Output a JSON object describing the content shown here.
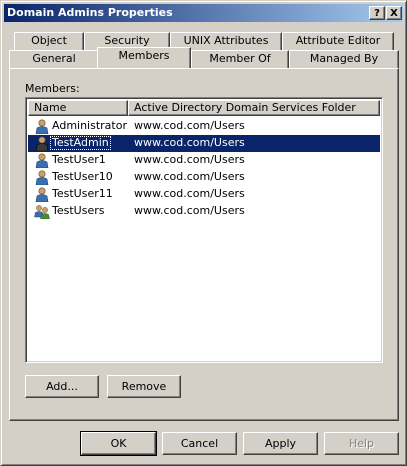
{
  "window": {
    "title": "Domain Admins Properties",
    "help_glyph": "?",
    "close_glyph": "X"
  },
  "tabs": {
    "back_row": [
      {
        "label": "Object"
      },
      {
        "label": "Security"
      },
      {
        "label": "UNIX Attributes"
      },
      {
        "label": "Attribute Editor"
      }
    ],
    "front_row": [
      {
        "label": "General"
      },
      {
        "label": "Members",
        "selected": true
      },
      {
        "label": "Member Of"
      },
      {
        "label": "Managed By"
      }
    ]
  },
  "members": {
    "label": "Members:",
    "columns": [
      "Name",
      "Active Directory Domain Services Folder"
    ],
    "rows": [
      {
        "name": "Administrator",
        "folder": "www.cod.com/Users",
        "icon": "user-icon"
      },
      {
        "name": "TestAdmin",
        "folder": "www.cod.com/Users",
        "icon": "user-icon",
        "selected": true
      },
      {
        "name": "TestUser1",
        "folder": "www.cod.com/Users",
        "icon": "user-icon"
      },
      {
        "name": "TestUser10",
        "folder": "www.cod.com/Users",
        "icon": "user-icon"
      },
      {
        "name": "TestUser11",
        "folder": "www.cod.com/Users",
        "icon": "user-icon"
      },
      {
        "name": "TestUsers",
        "folder": "www.cod.com/Users",
        "icon": "group-icon"
      }
    ],
    "add_button": "Add...",
    "remove_button": "Remove"
  },
  "footer": {
    "ok": "OK",
    "cancel": "Cancel",
    "apply": "Apply",
    "help": "Help"
  },
  "colors": {
    "face": "#d4d0c8",
    "selection": "#0a246a",
    "title_gradient_end": "#a6caf0"
  }
}
